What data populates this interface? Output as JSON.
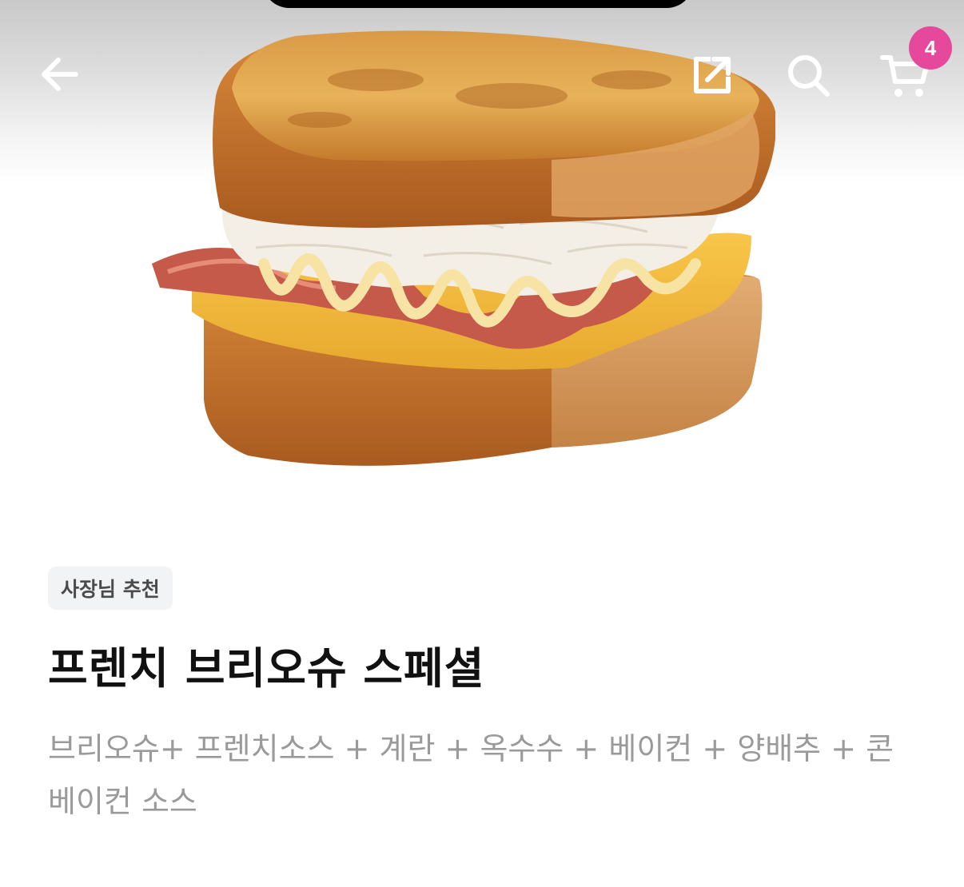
{
  "header": {
    "back_icon": "arrow-left-icon",
    "share_icon": "share-icon",
    "search_icon": "search-icon",
    "cart_icon": "cart-icon",
    "cart_count": "4",
    "badge_color": "#e6489b"
  },
  "product": {
    "image_alt": "sandwich photo",
    "tag": "사장님 추천",
    "name": "프렌치 브리오슈 스페셜",
    "description": "브리오슈+ 프렌치소스 + 계란 + 옥수수 + 베이컨 + 양배추 + 콘베이컨 소스"
  }
}
